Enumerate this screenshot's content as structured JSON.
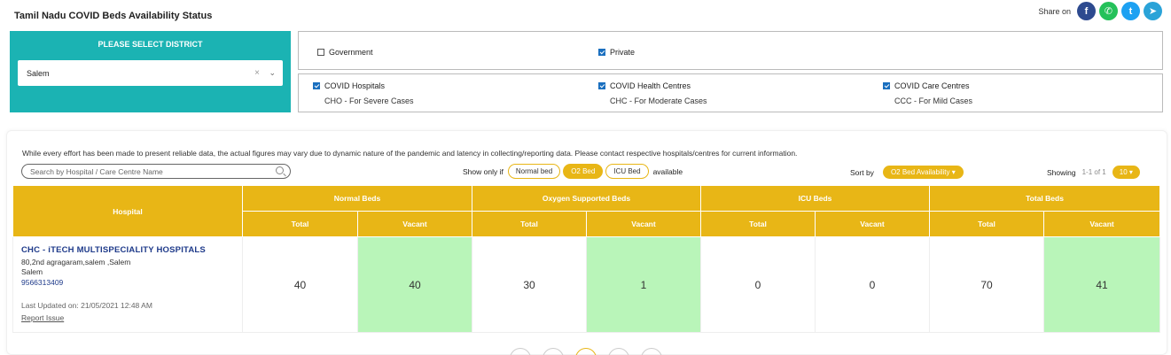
{
  "page_title": "Tamil Nadu COVID Beds Availability Status",
  "share": {
    "label": "Share on",
    "icons": [
      "facebook-icon",
      "whatsapp-icon",
      "twitter-icon",
      "telegram-icon"
    ]
  },
  "district": {
    "title": "PLEASE SELECT DISTRICT",
    "selected": "Salem",
    "clear": "×",
    "chevron": "⌄"
  },
  "types": [
    {
      "label": "Government",
      "checked": false
    },
    {
      "label": "Private",
      "checked": true
    }
  ],
  "categories": [
    {
      "label": "COVID Hospitals",
      "sub": "CHO - For Severe Cases",
      "checked": true
    },
    {
      "label": "COVID Health Centres",
      "sub": "CHC - For Moderate Cases",
      "checked": true
    },
    {
      "label": "COVID Care Centres",
      "sub": "CCC - For Mild Cases",
      "checked": true
    }
  ],
  "disclaimer": "While every effort has been made to present reliable data, the actual figures may vary due to dynamic nature of the pandemic and latency in collecting/reporting data. Please contact respective hospitals/centres for current information.",
  "search": {
    "placeholder": "Search by Hospital / Care Centre Name"
  },
  "filter": {
    "prefix": "Show only if",
    "options": [
      "Normal bed",
      "O2 Bed",
      "ICU Bed"
    ],
    "active": "O2 Bed",
    "suffix": "available"
  },
  "sort": {
    "label": "Sort by",
    "value": "O2 Bed Availability ▾"
  },
  "showing": {
    "label": "Showing",
    "count": "1-1 of 1",
    "page_size": "10 ▾"
  },
  "table": {
    "hospital_header": "Hospital",
    "groups": [
      "Normal Beds",
      "Oxygen Supported Beds",
      "ICU Beds",
      "Total Beds"
    ],
    "sub_headers": [
      "Total",
      "Vacant"
    ],
    "rows": [
      {
        "name": "CHC - iTECH MULTISPECIALITY HOSPITALS",
        "address": "80,2nd agragaram,salem ,Salem",
        "district": "Salem",
        "phone": "9566313409",
        "updated": "Last Updated on: 21/05/2021 12:48 AM",
        "report": "Report Issue",
        "normal_total": "40",
        "normal_vacant": "40",
        "o2_total": "30",
        "o2_vacant": "1",
        "icu_total": "0",
        "icu_vacant": "0",
        "total_total": "70",
        "total_vacant": "41"
      }
    ]
  }
}
